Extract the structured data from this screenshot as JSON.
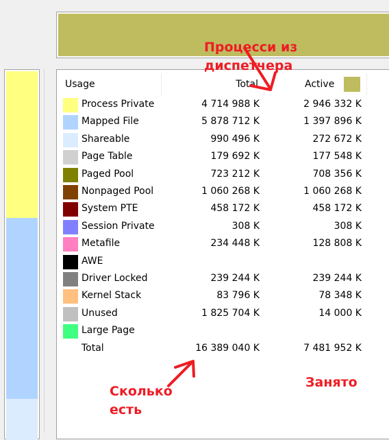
{
  "columns": {
    "usage": "Usage",
    "total": "Total",
    "active": "Active",
    "active_color": "#bfbc60"
  },
  "rows": [
    {
      "label": "Process Private",
      "color": "#ffff80",
      "total": "4 714 988 K",
      "active": "2 946 332 K"
    },
    {
      "label": "Mapped File",
      "color": "#b0d4ff",
      "total": "5 878 712 K",
      "active": "1 397 896 K"
    },
    {
      "label": "Shareable",
      "color": "#dcecff",
      "total": "990 496 K",
      "active": "272 672 K"
    },
    {
      "label": "Page Table",
      "color": "#d0d0d0",
      "total": "179 692 K",
      "active": "177 548 K"
    },
    {
      "label": "Paged Pool",
      "color": "#808000",
      "total": "723 212 K",
      "active": "708 356 K"
    },
    {
      "label": "Nonpaged Pool",
      "color": "#804000",
      "total": "1 060 268 K",
      "active": "1 060 268 K"
    },
    {
      "label": "System PTE",
      "color": "#800000",
      "total": "458 172 K",
      "active": "458 172 K"
    },
    {
      "label": "Session Private",
      "color": "#8080ff",
      "total": "308 K",
      "active": "308 K"
    },
    {
      "label": "Metafile",
      "color": "#ff80c0",
      "total": "234 448 K",
      "active": "128 808 K"
    },
    {
      "label": "AWE",
      "color": "#000000",
      "total": "",
      "active": ""
    },
    {
      "label": "Driver Locked",
      "color": "#808080",
      "total": "239 244 K",
      "active": "239 244 K"
    },
    {
      "label": "Kernel Stack",
      "color": "#ffc080",
      "total": "83 796 K",
      "active": "78 348 K"
    },
    {
      "label": "Unused",
      "color": "#c0c0c0",
      "total": "1 825 704 K",
      "active": "14 000 K"
    },
    {
      "label": "Large Page",
      "color": "#40ff80",
      "total": "",
      "active": ""
    }
  ],
  "total_row": {
    "label": "Total",
    "total": "16 389 040 K",
    "active": "7 481 952 K"
  },
  "annotations": {
    "top_line1": "Процесси из",
    "top_line2": "диспетчера",
    "bottom_line1": "Сколько",
    "bottom_line2": "есть",
    "right": "Занято",
    "color": "#ee1c24"
  }
}
